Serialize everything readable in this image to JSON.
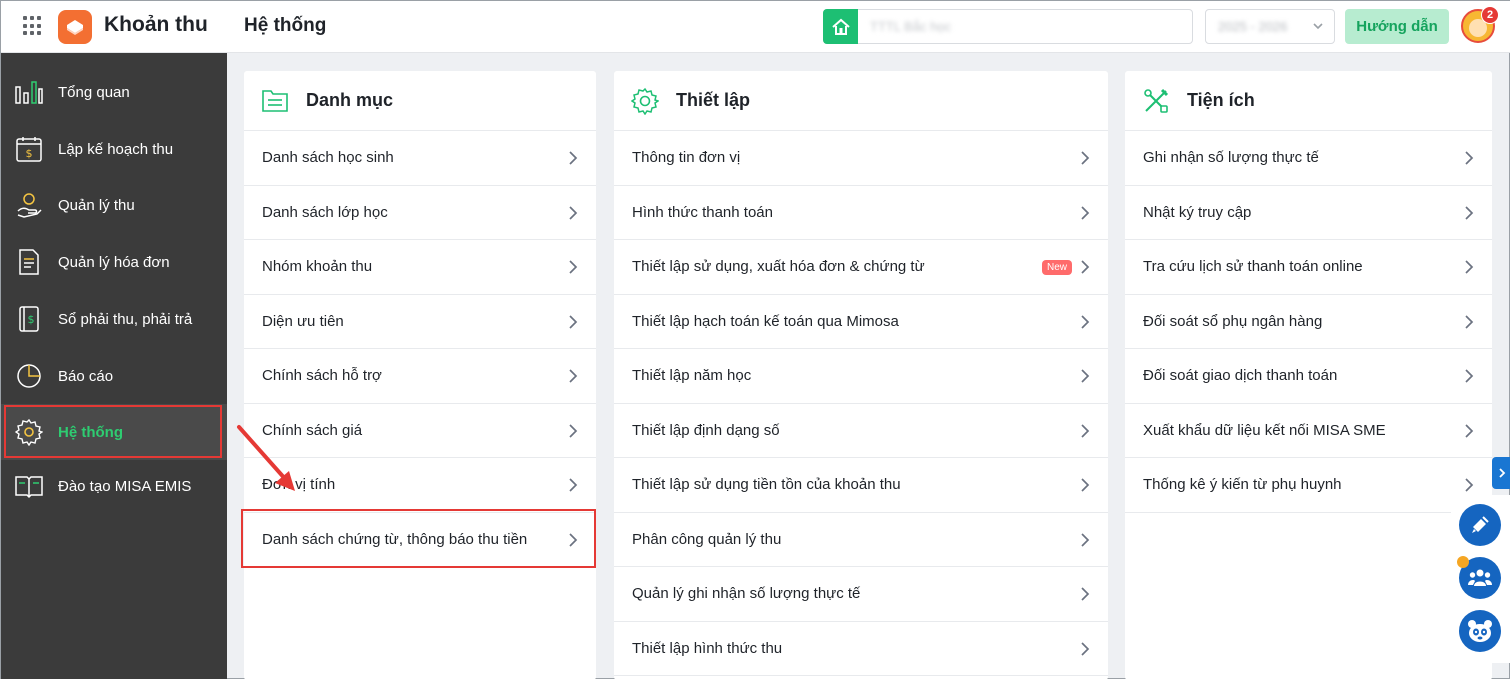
{
  "header": {
    "app_name": "Khoản thu",
    "page_title": "Hệ thống",
    "unit_placeholder": "TTTL Bắc học",
    "school_year": "2025 - 2026",
    "guide_label": "Hướng dẫn",
    "notification_count": "2"
  },
  "sidebar": {
    "items": [
      {
        "label": "Tổng quan",
        "icon": "bar-chart-icon"
      },
      {
        "label": "Lập kế hoạch thu",
        "icon": "calendar-money-icon"
      },
      {
        "label": "Quản lý thu",
        "icon": "hand-coin-icon"
      },
      {
        "label": "Quản lý hóa đơn",
        "icon": "invoice-icon"
      },
      {
        "label": "Sổ phải thu, phải trả",
        "icon": "ledger-icon"
      },
      {
        "label": "Báo cáo",
        "icon": "pie-chart-icon"
      },
      {
        "label": "Hệ thống",
        "icon": "gear-icon"
      },
      {
        "label": "Đào tạo MISA EMIS",
        "icon": "book-icon"
      }
    ],
    "active_index": 6
  },
  "columns": [
    {
      "title": "Danh mục",
      "icon": "folder-list-icon",
      "items": [
        {
          "label": "Danh sách học sinh"
        },
        {
          "label": "Danh sách lớp học"
        },
        {
          "label": "Nhóm khoản thu"
        },
        {
          "label": "Diện ưu tiên"
        },
        {
          "label": "Chính sách hỗ trợ"
        },
        {
          "label": "Chính sách giá"
        },
        {
          "label": "Đơn vị tính"
        },
        {
          "label": "Danh sách chứng từ, thông báo thu tiền"
        }
      ]
    },
    {
      "title": "Thiết lập",
      "icon": "gear-icon",
      "items": [
        {
          "label": "Thông tin đơn vị"
        },
        {
          "label": "Hình thức thanh toán"
        },
        {
          "label": "Thiết lập sử dụng, xuất hóa đơn & chứng từ",
          "badge": "New"
        },
        {
          "label": "Thiết lập hạch toán kế toán qua Mimosa"
        },
        {
          "label": "Thiết lập năm học"
        },
        {
          "label": "Thiết lập định dạng số"
        },
        {
          "label": "Thiết lập sử dụng tiền tồn của khoản thu"
        },
        {
          "label": "Phân công quản lý thu"
        },
        {
          "label": "Quản lý ghi nhận số lượng thực tế"
        },
        {
          "label": "Thiết lập hình thức thu"
        }
      ]
    },
    {
      "title": "Tiện ích",
      "icon": "tools-icon",
      "items": [
        {
          "label": "Ghi nhận số lượng thực tế"
        },
        {
          "label": "Nhật ký truy cập"
        },
        {
          "label": "Tra cứu lịch sử thanh toán online"
        },
        {
          "label": "Đối soát sổ phụ ngân hàng"
        },
        {
          "label": "Đối soát giao dịch thanh toán"
        },
        {
          "label": "Xuất khẩu dữ liệu kết nối MISA SME"
        },
        {
          "label": "Thống kê ý kiến từ phụ huynh"
        }
      ]
    }
  ],
  "colors": {
    "accent": "#1dbf73",
    "sidebar_bg": "#3b3b3b",
    "highlight": "#e53935",
    "fab": "#1565c0"
  }
}
